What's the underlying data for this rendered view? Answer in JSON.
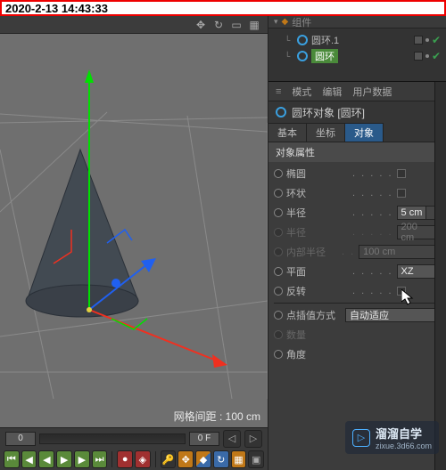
{
  "timestamp": "2020-2-13 14:43:33",
  "viewport": {
    "grid_label": "网格间距 : 100 cm"
  },
  "timeline": {
    "start": "0",
    "end": "0 F"
  },
  "objects": {
    "parent_label": "组件",
    "items": [
      {
        "label": "圆环.1",
        "selected": false
      },
      {
        "label": "圆环",
        "selected": true
      }
    ]
  },
  "attributes": {
    "header": {
      "mode": "模式",
      "edit": "编辑",
      "userdata": "用户数据"
    },
    "object_title": "圆环对象 [圆环]",
    "tabs": {
      "basic": "基本",
      "coord": "坐标",
      "object": "对象"
    },
    "section": "对象属性",
    "props": {
      "ellipse": "椭圆",
      "ring": "环状",
      "radius": "半径",
      "radius_val": "5 cm",
      "radius2": "半径",
      "radius2_val": "200 cm",
      "inner": "内部半径",
      "inner_val": "100 cm",
      "plane": "平面",
      "plane_val": "XZ",
      "reverse": "反转",
      "pointmode": "点插值方式",
      "pointmode_val": "自动适应",
      "count": "数量",
      "count_val": "",
      "angle": "角度",
      "angle_val": ""
    }
  },
  "watermark": {
    "brand": "溜溜自学",
    "url": "zixue.3d66.com"
  }
}
